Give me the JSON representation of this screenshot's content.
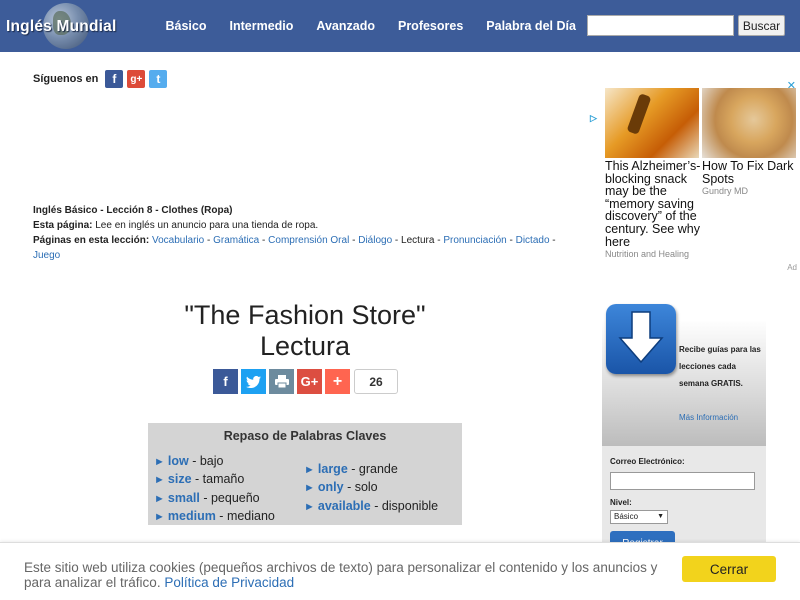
{
  "header": {
    "logo_text": "Inglés Mundial",
    "nav": [
      "Básico",
      "Intermedio",
      "Avanzado",
      "Profesores",
      "Palabra del Día"
    ],
    "search_placeholder": "",
    "search_button": "Buscar"
  },
  "social": {
    "label": "Síguenos en",
    "icons": [
      "facebook-icon",
      "google-plus-icon",
      "twitter-icon"
    ]
  },
  "lesson": {
    "title": "Inglés Básico - Lección 8 - Clothes (Ropa)",
    "page_label": "Esta página:",
    "page_desc": "Lee en inglés un anuncio para una tienda de ropa.",
    "pages_label": "Páginas en esta lección:",
    "links": [
      "Vocabulario",
      "Gramática",
      "Comprensión Oral",
      "Diálogo"
    ],
    "current": "Lectura",
    "links_after": [
      "Pronunciación",
      "Dictado",
      "Juego"
    ]
  },
  "ad": {
    "cards": [
      {
        "title": "This Alzheimer’s-blocking snack may be the “memory saving discovery” of the century. See why here",
        "source": "Nutrition and Healing"
      },
      {
        "title": "How To Fix Dark Spots",
        "source": "Gundry MD"
      }
    ],
    "tag": "Ad"
  },
  "page_title": {
    "line1": "\"The Fashion Store\"",
    "line2": "Lectura"
  },
  "share": {
    "count": "26",
    "buttons": [
      "facebook",
      "twitter",
      "print",
      "google-plus",
      "more"
    ]
  },
  "keywords": {
    "title": "Repaso de Palabras Claves",
    "col1": [
      {
        "en": "low",
        "es": "bajo"
      },
      {
        "en": "size",
        "es": "tamaño"
      },
      {
        "en": "small",
        "es": "pequeño"
      },
      {
        "en": "medium",
        "es": "mediano"
      }
    ],
    "col2": [
      {
        "en": "large",
        "es": "grande"
      },
      {
        "en": "only",
        "es": "solo"
      },
      {
        "en": "available",
        "es": "disponible"
      }
    ]
  },
  "signup": {
    "promo": "Recibe guías para las lecciones cada semana GRATIS.",
    "more": "Más Información",
    "email_label": "Correo Electrónico:",
    "level_label": "Nivel:",
    "level_value": "Básico",
    "register": "Registrar"
  },
  "cookie": {
    "message": "Este sitio web utiliza cookies (pequeños archivos de texto) para personalizar el contenido y los anuncios y para analizar el tráfico.",
    "link": "Política de Privacidad",
    "close": "Cerrar"
  },
  "colors": {
    "nav_bg": "#3d5c99",
    "link": "#2c6eb5",
    "keyword_box": "#d4d4d4",
    "cookie_button": "#f2d31c"
  }
}
